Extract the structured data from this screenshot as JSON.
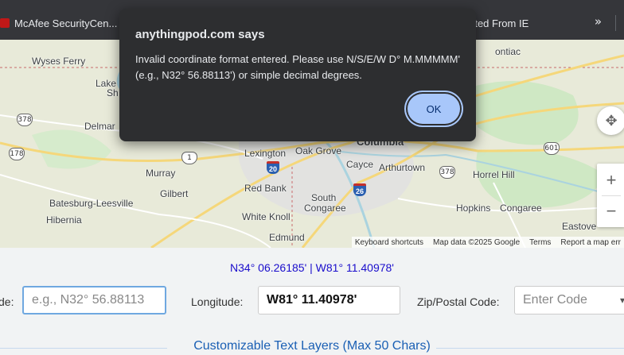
{
  "bookmarks": {
    "items": [
      {
        "label": "McAfee SecurityCen...",
        "color": "#c01818"
      },
      {
        "label": "rted From IE",
        "color": "#d0a020"
      }
    ],
    "overflow": "»"
  },
  "map": {
    "places": {
      "wyses_ferry": "Wyses Ferry",
      "lake": "Lake",
      "sh": "Sh",
      "delmar": "Delmar",
      "lexington": "Lexington",
      "oak_grove": "Oak Grove",
      "columbia": "Columbia",
      "murray": "Murray",
      "cayce": "Cayce",
      "arthurtown": "Arthurtown",
      "horrel_hill": "Horrel Hill",
      "gilbert": "Gilbert",
      "red_bank": "Red Bank",
      "south_congaree_1": "South",
      "south_congaree_2": "Congaree",
      "batesburg": "Batesburg-Leesville",
      "hopkins": "Hopkins",
      "congaree": "Congaree",
      "hibernia": "Hibernia",
      "white_knoll": "White Knoll",
      "edmund": "Edmund",
      "eastover": "Eastove",
      "pontiac": "ontiac"
    },
    "shields": {
      "us378_a": "378",
      "us178": "178",
      "us1": "1",
      "i20": "20",
      "i26": "26",
      "us378_b": "378",
      "us601": "601"
    },
    "attribution": {
      "keyboard": "Keyboard shortcuts",
      "data": "Map data ©2025 Google",
      "terms": "Terms",
      "report": "Report a map err"
    },
    "colors": {
      "land": "#e8ead9",
      "park": "#c8e6c0",
      "water": "#aad3df",
      "road_major": "#f5d77a",
      "urban": "#dcdcdc"
    }
  },
  "dialog": {
    "title": "anythingpod.com says",
    "message": "Invalid coordinate format entered. Please use N/S/E/W D° M.MMMMM' (e.g., N32° 56.88113') or simple decimal degrees.",
    "ok_label": "OK",
    "button_color": "#a8c7fa"
  },
  "coordinates": {
    "display": "N34° 06.26185' | W81° 11.40978'",
    "color": "#1a0dcc"
  },
  "form": {
    "latitude_label": "de:",
    "latitude_placeholder": "e.g., N32° 56.88113",
    "longitude_label": "Longitude:",
    "longitude_value": "W81° 11.40978'",
    "zip_label": "Zip/Postal Code:",
    "zip_placeholder": "Enter Code"
  },
  "section": {
    "title": "Customizable Text Layers (Max 50 Chars)"
  }
}
